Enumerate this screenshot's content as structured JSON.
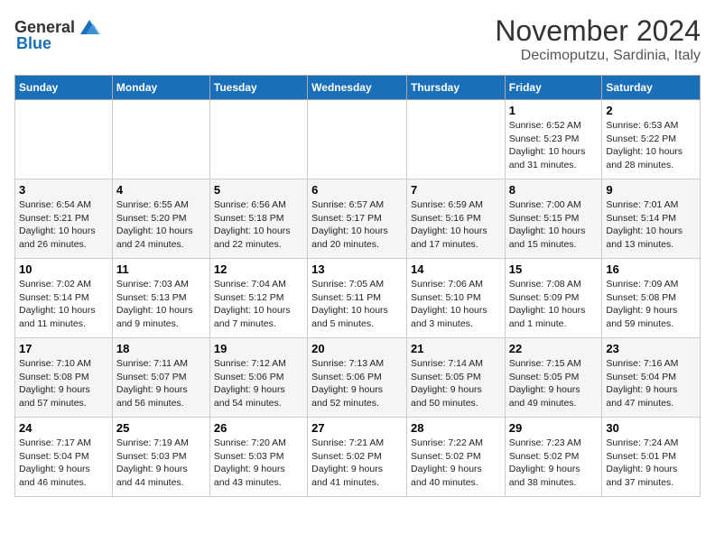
{
  "header": {
    "logo_general": "General",
    "logo_blue": "Blue",
    "month_title": "November 2024",
    "location": "Decimoputzu, Sardinia, Italy"
  },
  "weekdays": [
    "Sunday",
    "Monday",
    "Tuesday",
    "Wednesday",
    "Thursday",
    "Friday",
    "Saturday"
  ],
  "weeks": [
    [
      {
        "day": "",
        "info": ""
      },
      {
        "day": "",
        "info": ""
      },
      {
        "day": "",
        "info": ""
      },
      {
        "day": "",
        "info": ""
      },
      {
        "day": "",
        "info": ""
      },
      {
        "day": "1",
        "info": "Sunrise: 6:52 AM\nSunset: 5:23 PM\nDaylight: 10 hours\nand 31 minutes."
      },
      {
        "day": "2",
        "info": "Sunrise: 6:53 AM\nSunset: 5:22 PM\nDaylight: 10 hours\nand 28 minutes."
      }
    ],
    [
      {
        "day": "3",
        "info": "Sunrise: 6:54 AM\nSunset: 5:21 PM\nDaylight: 10 hours\nand 26 minutes."
      },
      {
        "day": "4",
        "info": "Sunrise: 6:55 AM\nSunset: 5:20 PM\nDaylight: 10 hours\nand 24 minutes."
      },
      {
        "day": "5",
        "info": "Sunrise: 6:56 AM\nSunset: 5:18 PM\nDaylight: 10 hours\nand 22 minutes."
      },
      {
        "day": "6",
        "info": "Sunrise: 6:57 AM\nSunset: 5:17 PM\nDaylight: 10 hours\nand 20 minutes."
      },
      {
        "day": "7",
        "info": "Sunrise: 6:59 AM\nSunset: 5:16 PM\nDaylight: 10 hours\nand 17 minutes."
      },
      {
        "day": "8",
        "info": "Sunrise: 7:00 AM\nSunset: 5:15 PM\nDaylight: 10 hours\nand 15 minutes."
      },
      {
        "day": "9",
        "info": "Sunrise: 7:01 AM\nSunset: 5:14 PM\nDaylight: 10 hours\nand 13 minutes."
      }
    ],
    [
      {
        "day": "10",
        "info": "Sunrise: 7:02 AM\nSunset: 5:14 PM\nDaylight: 10 hours\nand 11 minutes."
      },
      {
        "day": "11",
        "info": "Sunrise: 7:03 AM\nSunset: 5:13 PM\nDaylight: 10 hours\nand 9 minutes."
      },
      {
        "day": "12",
        "info": "Sunrise: 7:04 AM\nSunset: 5:12 PM\nDaylight: 10 hours\nand 7 minutes."
      },
      {
        "day": "13",
        "info": "Sunrise: 7:05 AM\nSunset: 5:11 PM\nDaylight: 10 hours\nand 5 minutes."
      },
      {
        "day": "14",
        "info": "Sunrise: 7:06 AM\nSunset: 5:10 PM\nDaylight: 10 hours\nand 3 minutes."
      },
      {
        "day": "15",
        "info": "Sunrise: 7:08 AM\nSunset: 5:09 PM\nDaylight: 10 hours\nand 1 minute."
      },
      {
        "day": "16",
        "info": "Sunrise: 7:09 AM\nSunset: 5:08 PM\nDaylight: 9 hours\nand 59 minutes."
      }
    ],
    [
      {
        "day": "17",
        "info": "Sunrise: 7:10 AM\nSunset: 5:08 PM\nDaylight: 9 hours\nand 57 minutes."
      },
      {
        "day": "18",
        "info": "Sunrise: 7:11 AM\nSunset: 5:07 PM\nDaylight: 9 hours\nand 56 minutes."
      },
      {
        "day": "19",
        "info": "Sunrise: 7:12 AM\nSunset: 5:06 PM\nDaylight: 9 hours\nand 54 minutes."
      },
      {
        "day": "20",
        "info": "Sunrise: 7:13 AM\nSunset: 5:06 PM\nDaylight: 9 hours\nand 52 minutes."
      },
      {
        "day": "21",
        "info": "Sunrise: 7:14 AM\nSunset: 5:05 PM\nDaylight: 9 hours\nand 50 minutes."
      },
      {
        "day": "22",
        "info": "Sunrise: 7:15 AM\nSunset: 5:05 PM\nDaylight: 9 hours\nand 49 minutes."
      },
      {
        "day": "23",
        "info": "Sunrise: 7:16 AM\nSunset: 5:04 PM\nDaylight: 9 hours\nand 47 minutes."
      }
    ],
    [
      {
        "day": "24",
        "info": "Sunrise: 7:17 AM\nSunset: 5:04 PM\nDaylight: 9 hours\nand 46 minutes."
      },
      {
        "day": "25",
        "info": "Sunrise: 7:19 AM\nSunset: 5:03 PM\nDaylight: 9 hours\nand 44 minutes."
      },
      {
        "day": "26",
        "info": "Sunrise: 7:20 AM\nSunset: 5:03 PM\nDaylight: 9 hours\nand 43 minutes."
      },
      {
        "day": "27",
        "info": "Sunrise: 7:21 AM\nSunset: 5:02 PM\nDaylight: 9 hours\nand 41 minutes."
      },
      {
        "day": "28",
        "info": "Sunrise: 7:22 AM\nSunset: 5:02 PM\nDaylight: 9 hours\nand 40 minutes."
      },
      {
        "day": "29",
        "info": "Sunrise: 7:23 AM\nSunset: 5:02 PM\nDaylight: 9 hours\nand 38 minutes."
      },
      {
        "day": "30",
        "info": "Sunrise: 7:24 AM\nSunset: 5:01 PM\nDaylight: 9 hours\nand 37 minutes."
      }
    ]
  ]
}
